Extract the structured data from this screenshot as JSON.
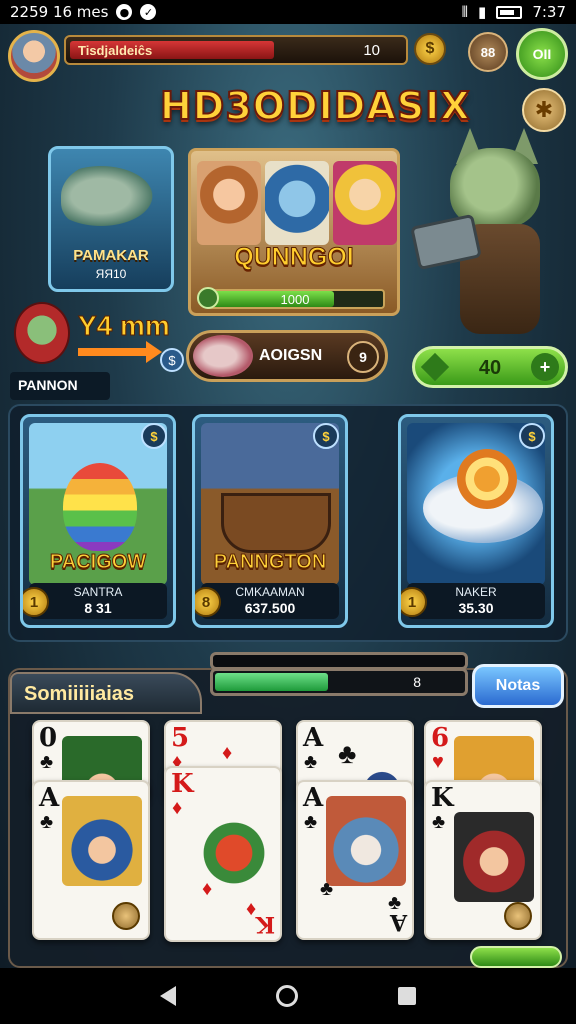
{
  "status_bar": {
    "left_text": "2259 16 mes",
    "time": "7:37"
  },
  "hud": {
    "player_name": "Tisdjaldeiĉs",
    "xp_value": "10",
    "xp_fraction": 0.6,
    "gem_count": "88",
    "shop_label": "OII"
  },
  "game_title": "HD3ODIDASIX",
  "feature_shark": {
    "title": "PAMAKAR",
    "subtitle": "ЯЯ10"
  },
  "feature_characters": {
    "name": "QUNNGOI",
    "progress_label": "1000",
    "progress_fraction": 0.72
  },
  "promo": {
    "multiplier": "Y4 mm",
    "label": "PANNON"
  },
  "event_pill": {
    "label": "AOIGSN",
    "count": "9"
  },
  "gems": {
    "value": "40",
    "plus": "+"
  },
  "game_cards": [
    {
      "title": "PACIGOW",
      "name": "SANTRA",
      "value": "8 31",
      "coin": "1"
    },
    {
      "title": "PANNGTON",
      "name": "CMKAAMAN",
      "value": "637.500",
      "coin": "8"
    },
    {
      "title": "",
      "name": "NAKER",
      "value": "35.30",
      "coin": "1"
    }
  ],
  "bottom_section": {
    "tab_label": "Somiiiiiaias",
    "progress_value": "8",
    "progress_fraction": 0.45,
    "notes_button": "Notas"
  },
  "playing_cards": [
    {
      "back_rank": "0",
      "back_suit": "♣",
      "front_rank": "A",
      "front_suit": "♣"
    },
    {
      "back_rank": "5",
      "back_suit": "♦",
      "front_rank": "K",
      "front_suit": "♦"
    },
    {
      "back_rank": "A",
      "back_suit": "♣",
      "front_rank": "A",
      "front_suit": "♣"
    },
    {
      "back_rank": "6",
      "back_suit": "♥",
      "front_rank": "K",
      "front_suit": "♣"
    }
  ],
  "colors": {
    "accent_gold": "#ffd23a",
    "accent_green": "#3a9a18",
    "panel_blue": "#7fc8ea"
  }
}
